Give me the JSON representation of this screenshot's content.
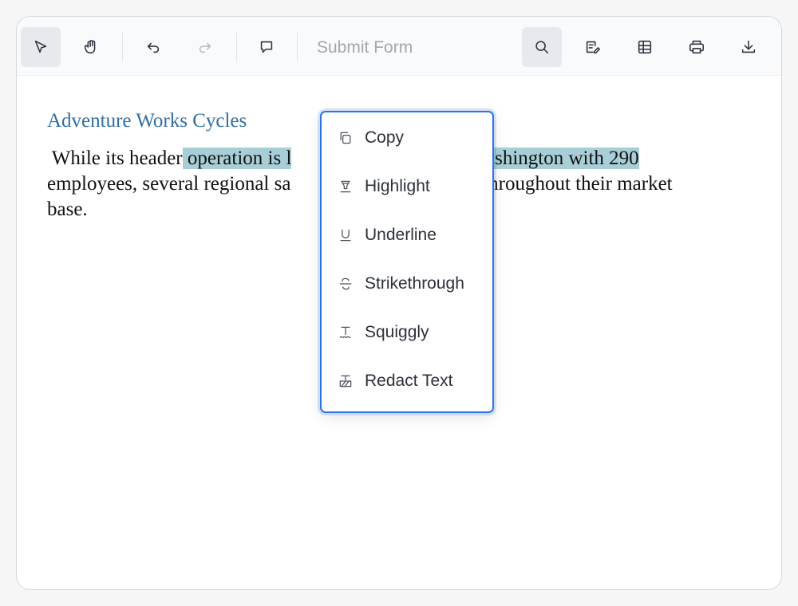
{
  "toolbar": {
    "tools": [
      {
        "name": "select-tool-button",
        "icon": "pointer-arrow-icon",
        "active": true
      },
      {
        "name": "pan-tool-button",
        "icon": "hand-icon",
        "active": false
      },
      {
        "name": "undo-button",
        "icon": "undo-icon",
        "active": false
      },
      {
        "name": "redo-button",
        "icon": "redo-icon",
        "active": false,
        "disabled": true
      },
      {
        "name": "comment-button",
        "icon": "comment-icon",
        "active": false
      }
    ],
    "submit_form_label": "Submit Form",
    "right_tools": [
      {
        "name": "search-button",
        "icon": "search-icon",
        "active": true
      },
      {
        "name": "annotate-button",
        "icon": "edit-annotation-icon"
      },
      {
        "name": "form-fields-button",
        "icon": "form-grid-icon"
      },
      {
        "name": "print-button",
        "icon": "printer-icon"
      },
      {
        "name": "download-button",
        "icon": "download-icon"
      }
    ]
  },
  "document": {
    "title": "Adventure Works Cycles",
    "line1_before": " While its header",
    "line1_highlight": " operation is l",
    "line1_highlight_after": "Washington with 290",
    "line2_before": "employees, several regional sa",
    "line2_after": "d throughout their market",
    "line3": "base.",
    "highlight_color": "#a8cfd8"
  },
  "context_menu": {
    "items": [
      {
        "label": "Copy",
        "icon": "copy-icon"
      },
      {
        "label": "Highlight",
        "icon": "highlighter-icon"
      },
      {
        "label": "Underline",
        "icon": "underline-icon"
      },
      {
        "label": "Strikethrough",
        "icon": "strikethrough-icon"
      },
      {
        "label": "Squiggly",
        "icon": "squiggly-icon"
      },
      {
        "label": "Redact Text",
        "icon": "redact-icon"
      }
    ],
    "border_color": "#2a73e8"
  }
}
